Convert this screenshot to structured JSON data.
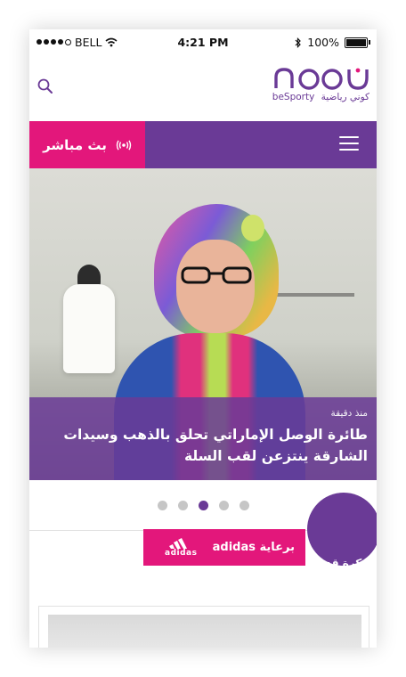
{
  "status_bar": {
    "carrier": "BELL",
    "time": "4:21 PM",
    "battery": "100%"
  },
  "header": {
    "logo_text": "beSporty",
    "logo_arabic": "كوني رياضية"
  },
  "navbar": {
    "live_label": "بث مباشر"
  },
  "hero": {
    "time_ago": "منذ دقيقة",
    "headline": "طائرة الوصل الإماراتي تحلق بالذهب وسيدات الشارقة ينتزعن لقب السلة"
  },
  "carousel": {
    "page_count": 5,
    "active_index": 2
  },
  "section": {
    "sponsor_label": "برعاية adidas",
    "sponsor_logo": "adidas",
    "category": "كرة قدم"
  },
  "colors": {
    "purple": "#6a3a96",
    "pink": "#e3177b"
  }
}
